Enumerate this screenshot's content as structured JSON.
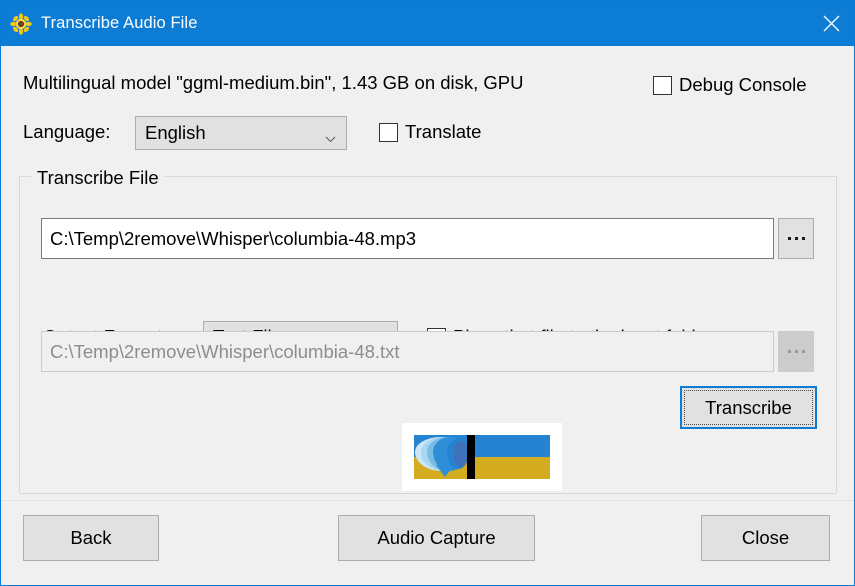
{
  "window": {
    "title": "Transcribe Audio File",
    "icon": "sunflower-icon",
    "close_icon": "close-icon",
    "titlebar_color": "#0c7cd5",
    "background_color": "#f0f0f0"
  },
  "main": {
    "model_info": "Multilingual model \"ggml-medium.bin\", 1.43 GB on disk, GPU",
    "debug_console": {
      "label": "Debug Console",
      "checked": false
    },
    "language": {
      "label": "Language:",
      "value": "English",
      "options": [
        "English"
      ]
    },
    "translate": {
      "label": "Translate",
      "checked": false
    }
  },
  "transcribe_group": {
    "title": "Transcribe File",
    "input_file": {
      "value": "C:\\Temp\\2remove\\Whisper\\columbia-48.mp3",
      "browse_label": "...",
      "enabled": true
    },
    "output_format": {
      "label": "Output Format:",
      "value": "Text File",
      "options": [
        "Text File"
      ]
    },
    "place_in_input_folder": {
      "label": "Place that file to the input folder",
      "checked": true
    },
    "output_file": {
      "value": "C:\\Temp\\2remove\\Whisper\\columbia-48.txt",
      "browse_label": "...",
      "enabled": false
    },
    "transcribe_button": {
      "label": "Transcribe",
      "focused": true
    },
    "banner": {
      "name": "speech-bubble-ukraine-flag-banner",
      "sky_color": "#2683d1",
      "field_color": "#d3ac20"
    }
  },
  "footer": {
    "back_label": "Back",
    "audio_capture_label": "Audio Capture",
    "close_label": "Close"
  }
}
